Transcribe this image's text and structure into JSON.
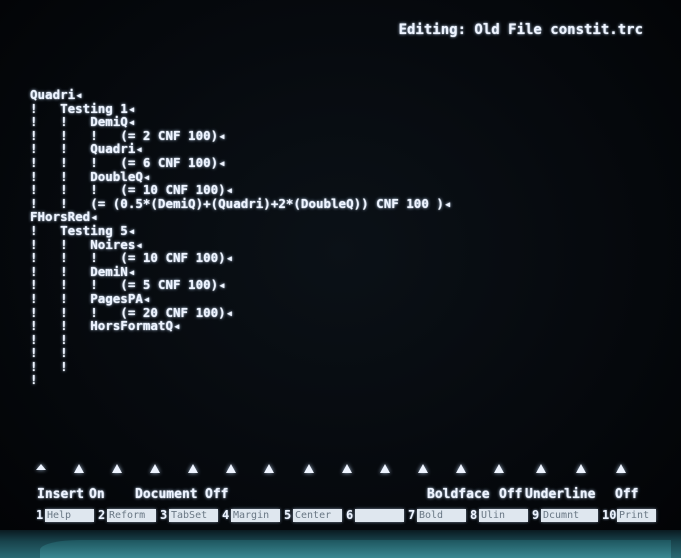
{
  "status_line": {
    "text": "Editing: Old File constit.trc"
  },
  "document": {
    "lines": [
      {
        "text": "Quadri",
        "end_mark": "◂"
      },
      {
        "text": "!   Testing 1",
        "end_mark": "◂"
      },
      {
        "text": "!   !   DemiQ",
        "end_mark": "◂"
      },
      {
        "text": "!   !   !   (= 2 CNF 100)",
        "end_mark": "◂"
      },
      {
        "text": "!   !   Quadri",
        "end_mark": "◂"
      },
      {
        "text": "!   !   !   (= 6 CNF 100)",
        "end_mark": "◂"
      },
      {
        "text": "!   !   DoubleQ",
        "end_mark": "◂"
      },
      {
        "text": "!   !   !   (= 10 CNF 100)",
        "end_mark": "◂"
      },
      {
        "text": "!   !   (= (0.5*(DemiQ)+(Quadri)+2*(DoubleQ)) CNF 100 )",
        "end_mark": "◂"
      },
      {
        "text": "FHorsRed",
        "end_mark": "◂"
      },
      {
        "text": "!   Testing 5",
        "end_mark": "◂"
      },
      {
        "text": "!   !   Noires",
        "end_mark": "◂"
      },
      {
        "text": "!   !   !   (= 10 CNF 100)",
        "end_mark": "◂"
      },
      {
        "text": "!   !   DemiN",
        "end_mark": "◂"
      },
      {
        "text": "!   !   !   (= 5 CNF 100)",
        "end_mark": "◂"
      },
      {
        "text": "!   !   PagesPA",
        "end_mark": "◂"
      },
      {
        "text": "!   !   !   (= 20 CNF 100)",
        "end_mark": "◂"
      },
      {
        "text": "!   !   HorsFormatQ",
        "end_mark": "◂"
      },
      {
        "text": "!   !",
        "end_mark": ""
      },
      {
        "text": "!   !",
        "end_mark": ""
      },
      {
        "text": "!   !",
        "end_mark": ""
      },
      {
        "text": "!",
        "end_mark": ""
      }
    ]
  },
  "modes": {
    "insert_label": "Insert",
    "insert_value": "On",
    "document_label": "Document",
    "document_value": "Off",
    "boldface_label": "Boldface",
    "boldface_value": "Off",
    "underline_label": "Underline",
    "underline_value": "Off"
  },
  "function_keys": [
    {
      "num": "1",
      "label": "Help"
    },
    {
      "num": "2",
      "label": "Reform"
    },
    {
      "num": "3",
      "label": "TabSet"
    },
    {
      "num": "4",
      "label": "Margin"
    },
    {
      "num": "5",
      "label": "Center"
    },
    {
      "num": "6",
      "label": ""
    },
    {
      "num": "7",
      "label": "Bold"
    },
    {
      "num": "8",
      "label": "Ulin"
    },
    {
      "num": "9",
      "label": "Dcumnt"
    },
    {
      "num": "10",
      "label": "Print"
    }
  ],
  "colors": {
    "phosphor": "#eef4ff",
    "key_label_bg": "#dfe7ef",
    "key_label_text": "#6a7885",
    "bezel": "#2a6a74"
  }
}
